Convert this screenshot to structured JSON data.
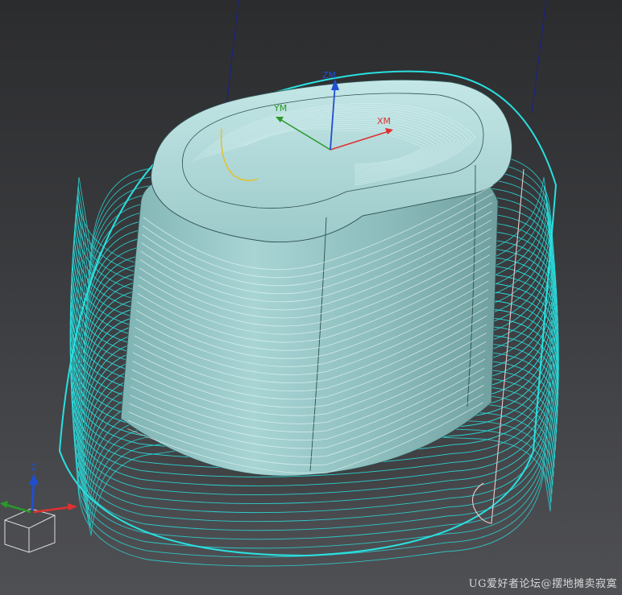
{
  "viewport": {
    "background_top": "#2b2c2e",
    "background_bottom": "#4f5054"
  },
  "wcs": {
    "x_label": "XM",
    "y_label": "YM",
    "z_label": "ZM",
    "x_color": "#e03030",
    "y_color": "#2a9a2a",
    "z_color": "#1f4fd0"
  },
  "triad": {
    "z_label": "Z",
    "x_color": "#e03030",
    "y_color": "#2a9a2a",
    "z_color": "#1f4fd0"
  },
  "colors": {
    "toolpath": "#29e0e0",
    "part_surface": "#8fc4c4",
    "engage_move": "#e8c020",
    "retract_move": "#f0c8c8",
    "tool_axis": "#1a237e"
  },
  "watermark": "UG爱好者论坛@摆地摊卖寂寞"
}
